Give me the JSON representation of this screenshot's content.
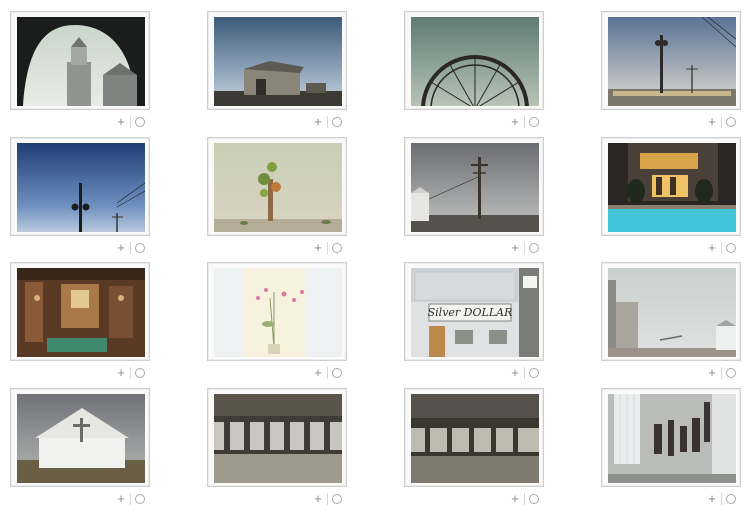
{
  "gallery": {
    "add_symbol": "+",
    "photos": [
      {
        "subject": "church-tower-arch"
      },
      {
        "subject": "shed-on-plain"
      },
      {
        "subject": "ferris-wheel"
      },
      {
        "subject": "lamp-post-bridge"
      },
      {
        "subject": "street-lamp-sky"
      },
      {
        "subject": "tree-sculpture"
      },
      {
        "subject": "telephone-pole"
      },
      {
        "subject": "pool-house-night"
      },
      {
        "subject": "cluttered-interior"
      },
      {
        "subject": "pink-flowers-vase"
      },
      {
        "subject": "silver-dollar-storefront",
        "sign_text": "Silver DOLLAR"
      },
      {
        "subject": "coastal-buildings"
      },
      {
        "subject": "white-chapel"
      },
      {
        "subject": "abandoned-hall-1"
      },
      {
        "subject": "abandoned-hall-2"
      },
      {
        "subject": "hanging-clothes"
      }
    ]
  }
}
